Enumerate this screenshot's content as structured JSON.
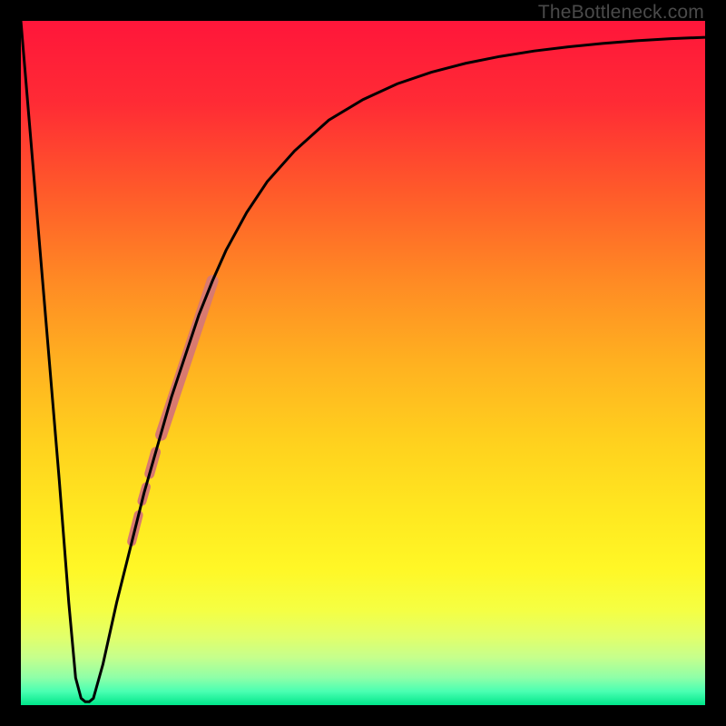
{
  "watermark": "TheBottleneck.com",
  "chart_data": {
    "type": "line",
    "title": "",
    "xlabel": "",
    "ylabel": "",
    "xlim": [
      0,
      100
    ],
    "ylim": [
      0,
      100
    ],
    "gradient_stops": [
      {
        "offset": 0.0,
        "color": "#ff163a"
      },
      {
        "offset": 0.12,
        "color": "#ff2b35"
      },
      {
        "offset": 0.25,
        "color": "#ff5a2a"
      },
      {
        "offset": 0.38,
        "color": "#ff8a24"
      },
      {
        "offset": 0.5,
        "color": "#ffb120"
      },
      {
        "offset": 0.62,
        "color": "#ffd21e"
      },
      {
        "offset": 0.72,
        "color": "#ffe820"
      },
      {
        "offset": 0.8,
        "color": "#fff726"
      },
      {
        "offset": 0.86,
        "color": "#f5ff42"
      },
      {
        "offset": 0.9,
        "color": "#e2ff6a"
      },
      {
        "offset": 0.93,
        "color": "#c6ff8c"
      },
      {
        "offset": 0.96,
        "color": "#8effa8"
      },
      {
        "offset": 0.98,
        "color": "#4affb2"
      },
      {
        "offset": 1.0,
        "color": "#00e68a"
      }
    ],
    "series": [
      {
        "name": "main-curve",
        "color": "#000000",
        "points": [
          {
            "x": 0.0,
            "y": 100.0
          },
          {
            "x": 5.6,
            "y": 33.0
          },
          {
            "x": 7.0,
            "y": 15.0
          },
          {
            "x": 8.0,
            "y": 4.0
          },
          {
            "x": 8.8,
            "y": 1.0
          },
          {
            "x": 9.4,
            "y": 0.5
          },
          {
            "x": 10.0,
            "y": 0.5
          },
          {
            "x": 10.6,
            "y": 1.0
          },
          {
            "x": 12.0,
            "y": 6.0
          },
          {
            "x": 14.0,
            "y": 15.0
          },
          {
            "x": 16.0,
            "y": 23.0
          },
          {
            "x": 18.0,
            "y": 31.0
          },
          {
            "x": 20.0,
            "y": 38.0
          },
          {
            "x": 22.0,
            "y": 45.0
          },
          {
            "x": 24.0,
            "y": 51.0
          },
          {
            "x": 26.0,
            "y": 57.0
          },
          {
            "x": 28.0,
            "y": 62.0
          },
          {
            "x": 30.0,
            "y": 66.5
          },
          {
            "x": 33.0,
            "y": 72.0
          },
          {
            "x": 36.0,
            "y": 76.5
          },
          {
            "x": 40.0,
            "y": 81.0
          },
          {
            "x": 45.0,
            "y": 85.5
          },
          {
            "x": 50.0,
            "y": 88.5
          },
          {
            "x": 55.0,
            "y": 90.8
          },
          {
            "x": 60.0,
            "y": 92.5
          },
          {
            "x": 65.0,
            "y": 93.8
          },
          {
            "x": 70.0,
            "y": 94.8
          },
          {
            "x": 75.0,
            "y": 95.6
          },
          {
            "x": 80.0,
            "y": 96.2
          },
          {
            "x": 85.0,
            "y": 96.7
          },
          {
            "x": 90.0,
            "y": 97.1
          },
          {
            "x": 95.0,
            "y": 97.4
          },
          {
            "x": 100.0,
            "y": 97.6
          }
        ]
      }
    ],
    "highlighted_region": {
      "color": "#d87a70",
      "segments": [
        {
          "x1": 20.5,
          "y1": 39.5,
          "x2": 28.0,
          "y2": 62.0,
          "width": 13
        },
        {
          "x1": 18.8,
          "y1": 33.8,
          "x2": 19.7,
          "y2": 37.0,
          "width": 11
        },
        {
          "x1": 17.7,
          "y1": 29.8,
          "x2": 18.3,
          "y2": 31.9,
          "width": 10
        },
        {
          "x1": 16.2,
          "y1": 23.9,
          "x2": 17.2,
          "y2": 27.8,
          "width": 10
        }
      ]
    }
  }
}
